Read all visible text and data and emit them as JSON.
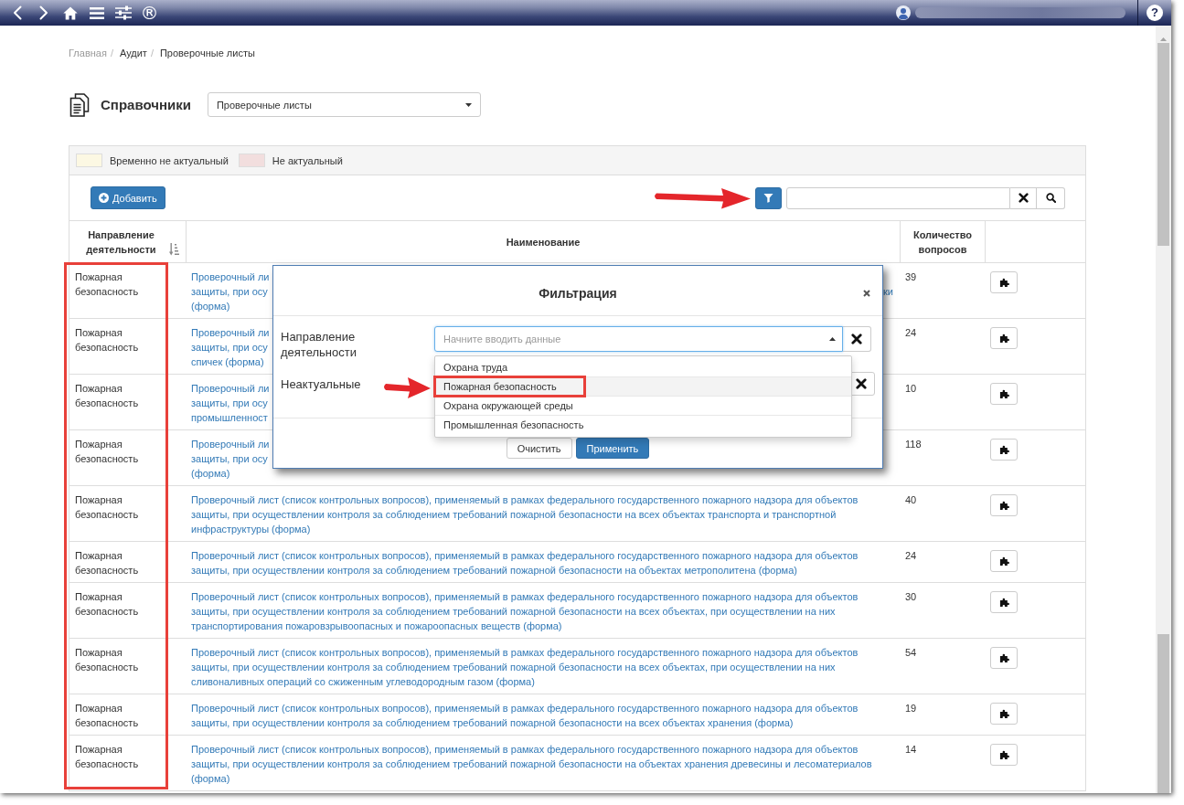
{
  "nav_bar": {
    "brand_mark": "®",
    "help_mark": "?"
  },
  "breadcrumb": {
    "separator": "/",
    "items": [
      {
        "label": "Главная",
        "muted": true
      },
      {
        "label": "Аудит",
        "muted": false
      },
      {
        "label": "Проверочные листы",
        "muted": false
      }
    ]
  },
  "header": {
    "title": "Справочники",
    "reference_select": {
      "value": "Проверочные листы"
    }
  },
  "legend": [
    {
      "label": "Временно не актуальный",
      "color": "#fcf8e3"
    },
    {
      "label": "Не актуальный",
      "color": "#f2dede"
    }
  ],
  "toolbar": {
    "add_button": {
      "label": "Добавить"
    },
    "filter_button": {
      "annotated": true
    }
  },
  "table": {
    "columns": [
      {
        "label": "Направление деятельности",
        "sortable": true,
        "highlighted": true
      },
      {
        "label": "Наименование",
        "sortable": false,
        "highlighted": false
      },
      {
        "label": "Количество вопросов",
        "sortable": false,
        "highlighted": false
      }
    ],
    "rows": [
      {
        "direction": "Пожарная безопасность",
        "name_fragments": [
          {
            "left": "Проверочный ли"
          },
          {
            "left": "защиты, при осу",
            "right": "ки"
          },
          {
            "left": "(форма)"
          }
        ],
        "questions": "39"
      },
      {
        "direction": "Пожарная безопасность",
        "name_fragments": [
          {
            "left": "Проверочный ли"
          },
          {
            "left": "защиты, при осу"
          },
          {
            "left": "спичек (форма)"
          }
        ],
        "questions": "24"
      },
      {
        "direction": "Пожарная безопасность",
        "name_fragments": [
          {
            "left": "Проверочный ли"
          },
          {
            "left": "защиты, при осу"
          },
          {
            "left": "промышленност"
          }
        ],
        "questions": "10"
      },
      {
        "direction": "Пожарная безопасность",
        "name_fragments": [
          {
            "left": "Проверочный ли"
          },
          {
            "left": "защиты, при осу"
          },
          {
            "left": "(форма)"
          }
        ],
        "questions": "118"
      },
      {
        "direction": "Пожарная безопасность",
        "name": "Проверочный лист (список контрольных вопросов), применяемый в рамках федерального государственного пожарного надзора для объектов защиты, при осуществлении контроля за соблюдением требований пожарной безопасности на всех объектах транспорта и транспортной инфраструктуры (форма)",
        "questions": "40"
      },
      {
        "direction": "Пожарная безопасность",
        "name": "Проверочный лист (список контрольных вопросов), применяемый в рамках федерального государственного пожарного надзора для объектов защиты, при осуществлении контроля за соблюдением требований пожарной безопасности на объектах метрополитена (форма)",
        "questions": "24"
      },
      {
        "direction": "Пожарная безопасность",
        "name": "Проверочный лист (список контрольных вопросов), применяемый в рамках федерального государственного пожарного надзора для объектов защиты, при осуществлении контроля за соблюдением требований пожарной безопасности на всех объектах, при осуществлении на них транспортирования пожаровзрывоопасных и пожароопасных веществ (форма)",
        "questions": "30"
      },
      {
        "direction": "Пожарная безопасность",
        "name": "Проверочный лист (список контрольных вопросов), применяемый в рамках федерального государственного пожарного надзора для объектов защиты, при осуществлении контроля за соблюдением требований пожарной безопасности на всех объектах, при осуществлении на них сливоналивных операций со сжиженным углеводородным газом (форма)",
        "questions": "54"
      },
      {
        "direction": "Пожарная безопасность",
        "name": "Проверочный лист (список контрольных вопросов), применяемый в рамках федерального государственного пожарного надзора для объектов защиты, при осуществлении контроля за соблюдением требований пожарной безопасности на всех объектах хранения (форма)",
        "questions": "19"
      },
      {
        "direction": "Пожарная безопасность",
        "name": "Проверочный лист (список контрольных вопросов), применяемый в рамках федерального государственного пожарного надзора для объектов защиты, при осуществлении контроля за соблюдением требований пожарной безопасности на объектах хранения древесины и лесоматериалов (форма)",
        "questions": "14"
      }
    ]
  },
  "filter_dialog": {
    "title": "Фильтрация",
    "fields": [
      {
        "label": "Направление деятельности",
        "placeholder": "Начните вводить данные",
        "expanded": true,
        "options": [
          {
            "label": "Охрана труда",
            "selected": false,
            "highlighted": false
          },
          {
            "label": "Пожарная безопасность",
            "selected": true,
            "highlighted": true
          },
          {
            "label": "Охрана окружающей среды",
            "selected": false,
            "highlighted": false
          },
          {
            "label": "Промышленная безопасность",
            "selected": false,
            "highlighted": false
          }
        ]
      },
      {
        "label": "Неактуальные"
      }
    ],
    "buttons": [
      {
        "label": "Очистить",
        "kind": "default"
      },
      {
        "label": "Применить",
        "kind": "primary"
      }
    ]
  }
}
